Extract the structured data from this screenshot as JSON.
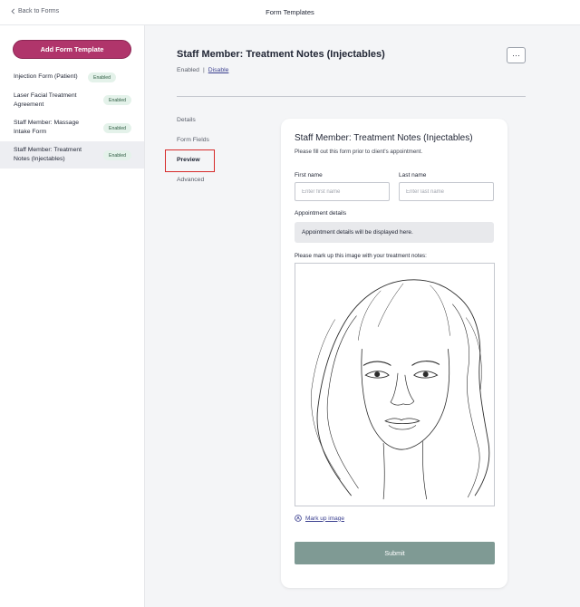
{
  "topbar": {
    "back_label": "Back to Forms",
    "title": "Form Templates"
  },
  "sidebar": {
    "add_button": "Add Form Template",
    "templates": [
      {
        "name_lines": [
          "Injection Form (Patient)"
        ],
        "status": "Enabled"
      },
      {
        "name_lines": [
          "Laser Facial Treatment",
          "Agreement"
        ],
        "status": "Enabled"
      },
      {
        "name_lines": [
          "Staff Member: Massage",
          "Intake Form"
        ],
        "status": "Enabled"
      },
      {
        "name_lines": [
          "Staff Member: Treatment",
          "Notes (Injectables)"
        ],
        "status": "Enabled",
        "selected": true
      }
    ]
  },
  "header": {
    "title": "Staff Member: Treatment Notes (Injectables)",
    "status": "Enabled",
    "separator": "|",
    "disable_link": "Disable",
    "more_label": "···"
  },
  "subnav": {
    "details": "Details",
    "form_fields": "Form Fields",
    "preview": "Preview",
    "advanced": "Advanced",
    "active": "preview"
  },
  "preview": {
    "title": "Staff Member: Treatment Notes (Injectables)",
    "description": "Please fill out this form prior to client's appointment.",
    "first_name_label": "First name",
    "first_name_placeholder": "Enter first name",
    "last_name_label": "Last name",
    "last_name_placeholder": "Enter last name",
    "appointment_label": "Appointment details",
    "appointment_text": "Appointment details will be displayed here.",
    "image_label": "Please mark up this image with your treatment notes:",
    "markup_link": "Mark up image",
    "submit_label": "Submit"
  },
  "icons": {
    "back": "chevron-left-icon",
    "markup": "pen-circle-icon",
    "more": "ellipsis-icon"
  },
  "colors": {
    "accent": "#b0356b",
    "badge_bg": "#e4f2ea",
    "submit": "#7f9a94",
    "highlight": "#d62a2a"
  }
}
